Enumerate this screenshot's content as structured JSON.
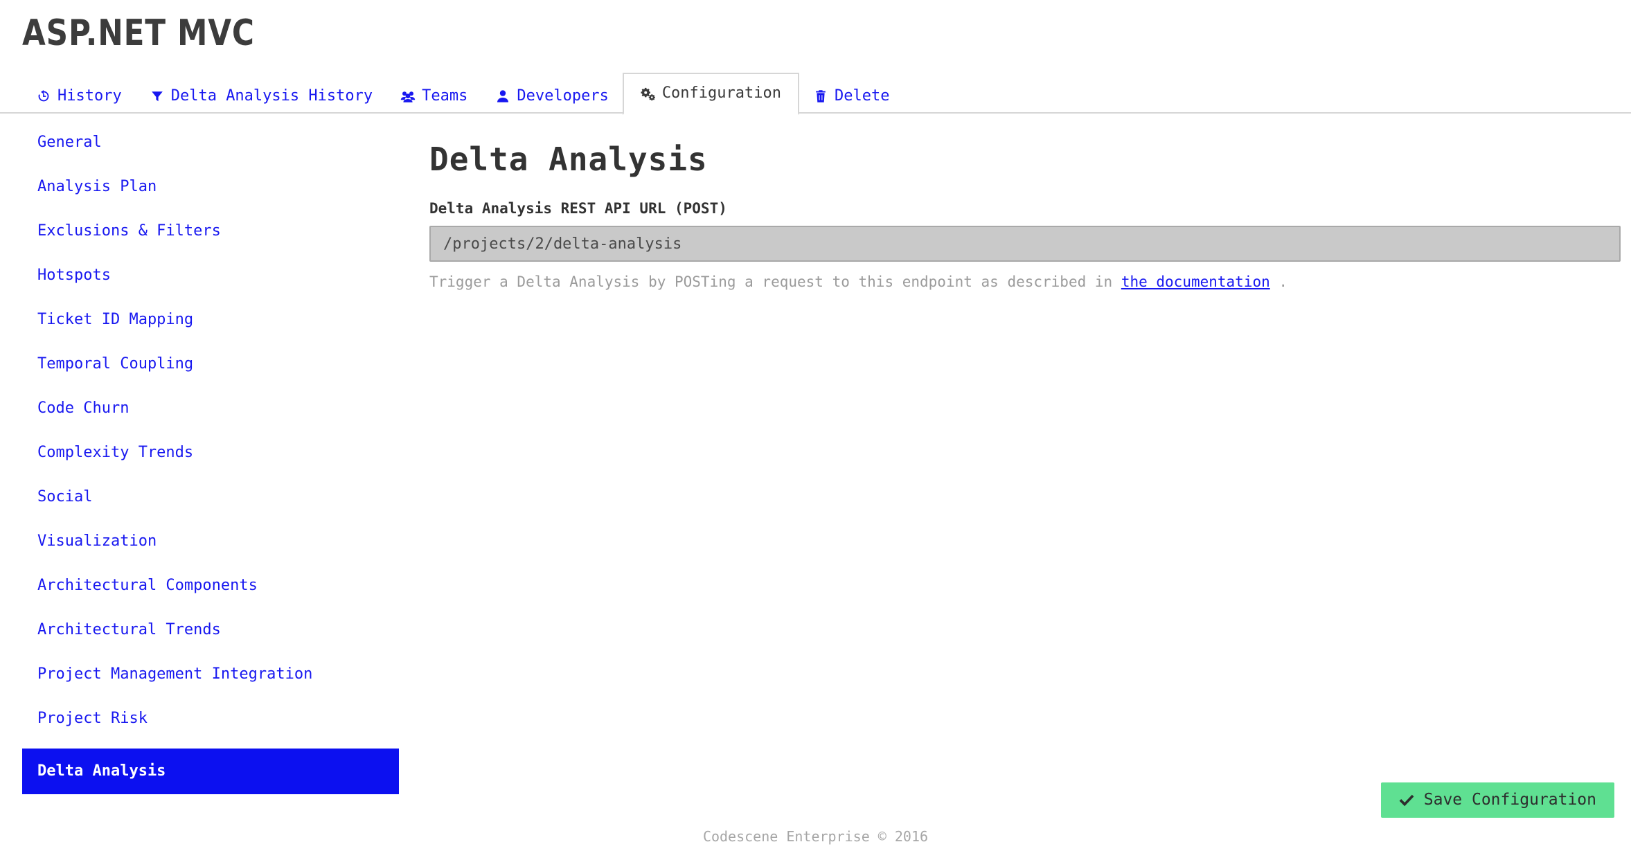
{
  "header": {
    "brand": "ASP.NET MVC"
  },
  "tabs": [
    {
      "label": "History",
      "icon": "history-icon",
      "active": false
    },
    {
      "label": "Delta Analysis History",
      "icon": "filter-icon",
      "active": false
    },
    {
      "label": "Teams",
      "icon": "users-icon",
      "active": false
    },
    {
      "label": "Developers",
      "icon": "user-icon",
      "active": false
    },
    {
      "label": "Configuration",
      "icon": "gears-icon",
      "active": true
    },
    {
      "label": "Delete",
      "icon": "trash-icon",
      "active": false
    }
  ],
  "sidebar": {
    "items": [
      {
        "label": "General",
        "active": false
      },
      {
        "label": "Analysis Plan",
        "active": false
      },
      {
        "label": "Exclusions & Filters",
        "active": false
      },
      {
        "label": "Hotspots",
        "active": false
      },
      {
        "label": "Ticket ID Mapping",
        "active": false
      },
      {
        "label": "Temporal Coupling",
        "active": false
      },
      {
        "label": "Code Churn",
        "active": false
      },
      {
        "label": "Complexity Trends",
        "active": false
      },
      {
        "label": "Social",
        "active": false
      },
      {
        "label": "Visualization",
        "active": false
      },
      {
        "label": "Architectural Components",
        "active": false
      },
      {
        "label": "Architectural Trends",
        "active": false
      },
      {
        "label": "Project Management Integration",
        "active": false
      },
      {
        "label": "Project Risk",
        "active": false
      },
      {
        "label": "Delta Analysis",
        "active": true
      }
    ]
  },
  "main": {
    "title": "Delta Analysis",
    "field_label": "Delta Analysis REST API URL (POST)",
    "field_value": "/projects/2/delta-analysis",
    "field_placeholder": "",
    "help_prefix": "Trigger a Delta Analysis by POSTing a request to this endpoint as described in ",
    "help_link": "the documentation",
    "help_suffix": " ."
  },
  "actions": {
    "save_label": "Save Configuration"
  },
  "footer": {
    "text": "Codescene Enterprise © 2016"
  },
  "colors": {
    "link": "#1818f0",
    "active_nav_bg": "#0c10f0",
    "save_button_bg": "#5fe092",
    "disabled_input_bg": "#c9c9c9",
    "muted_text": "#9b9b9b"
  }
}
